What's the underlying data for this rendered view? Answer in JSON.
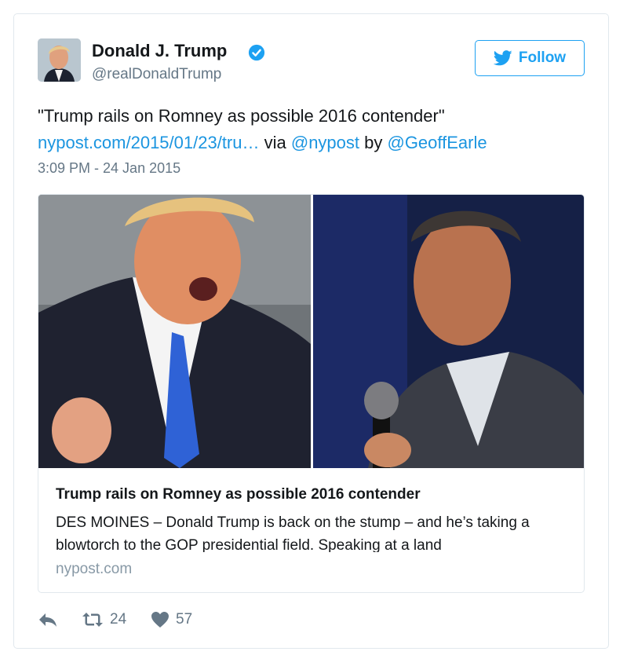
{
  "user": {
    "name": "Donald J. Trump",
    "handle": "@realDonaldTrump",
    "verified": true
  },
  "follow_button": {
    "label": "Follow",
    "icon": "twitter-bird-icon"
  },
  "tweet": {
    "quote": "\"Trump rails on Romney as possible 2016 contender\"",
    "link_text": "nypost.com/2015/01/23/tru…",
    "via_text": " via ",
    "via_handle": "@nypost",
    "by_text": " by ",
    "by_handle": "@GeoffEarle",
    "timestamp": "3:09 PM - 24 Jan 2015"
  },
  "card": {
    "title": "Trump rails on Romney as possible 2016 contender",
    "description": "DES MOINES – Donald Trump is back on the stump – and he’s taking a blowtorch to the GOP presidential field. Speaking at a land",
    "domain": "nypost.com"
  },
  "actions": {
    "reply_icon": "reply-icon",
    "retweet_icon": "retweet-icon",
    "retweet_count": "24",
    "like_icon": "heart-icon",
    "like_count": "57"
  },
  "colors": {
    "link": "#1b95e0",
    "brand_blue": "#1da1f2",
    "secondary_text": "#657786",
    "border": "#e1e8ed"
  }
}
